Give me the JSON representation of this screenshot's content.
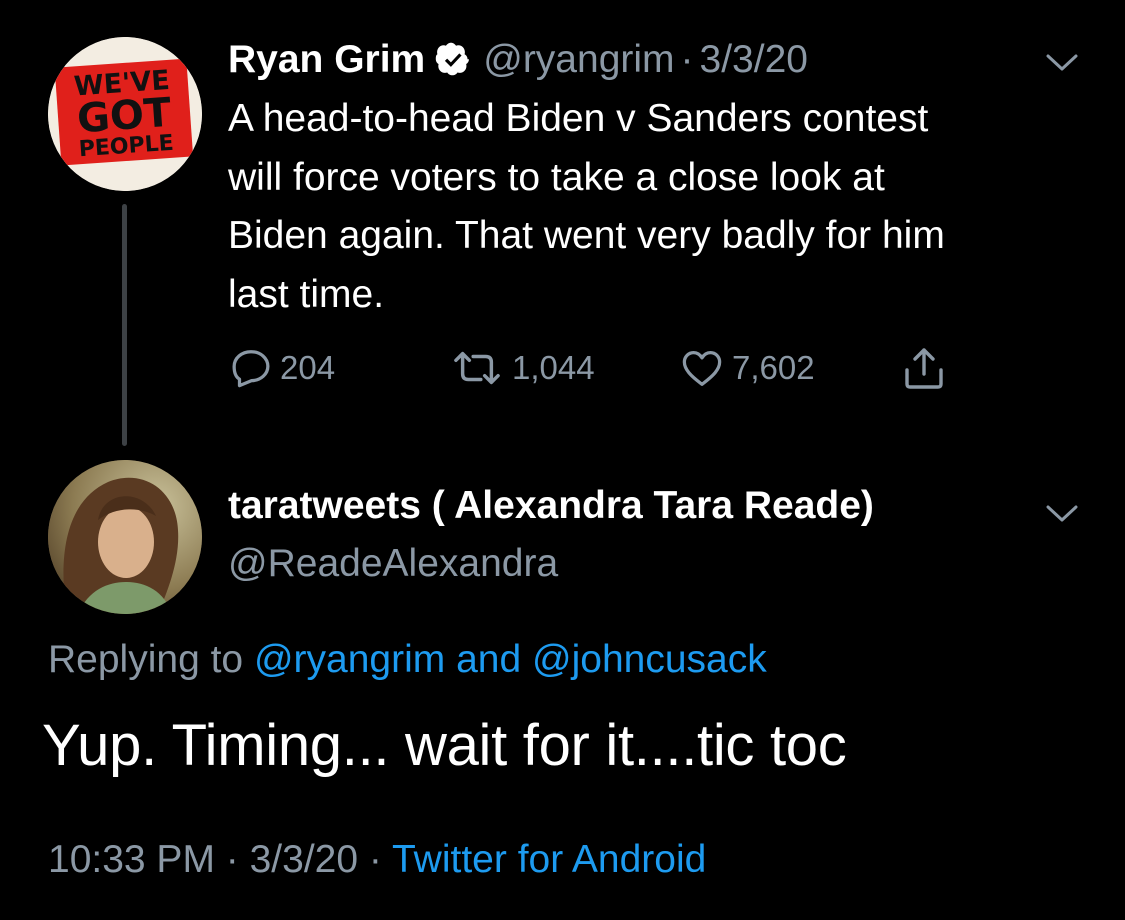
{
  "colors": {
    "background": "#000000",
    "text": "#ffffff",
    "secondary": "#8b98a5",
    "link": "#1d9bf0",
    "verified": "#ffffff",
    "sign_red": "#e0201b"
  },
  "original_tweet": {
    "avatar_text": [
      "WE'VE",
      "GOT",
      "PEOPLE"
    ],
    "name": "Ryan Grim",
    "verified_icon": "verified-badge",
    "handle": "@ryangrim",
    "separator": "·",
    "date": "3/3/20",
    "menu_icon": "chevron-down-icon",
    "text_lines": [
      "A head-to-head Biden v Sanders contest",
      "will force voters to take a close look at",
      "Biden again. That went very badly for him",
      "last time."
    ],
    "actions": {
      "reply": {
        "icon": "reply-icon",
        "count": "204"
      },
      "retweet": {
        "icon": "retweet-icon",
        "count": "1,044"
      },
      "like": {
        "icon": "heart-icon",
        "count": "7,602"
      },
      "share": {
        "icon": "share-icon"
      }
    }
  },
  "reply_tweet": {
    "name": "taratweets ( Alexandra Tara Reade)",
    "handle": "@ReadeAlexandra",
    "menu_icon": "chevron-down-icon",
    "replying_prefix": "Replying to ",
    "replying_user1": "@ryangrim",
    "replying_and": " and ",
    "replying_user2": "@johncusack",
    "text": "Yup. Timing... wait for it....tic toc",
    "time": "10:33 PM",
    "separator": " · ",
    "date": "3/3/20",
    "source": "Twitter for Android"
  }
}
